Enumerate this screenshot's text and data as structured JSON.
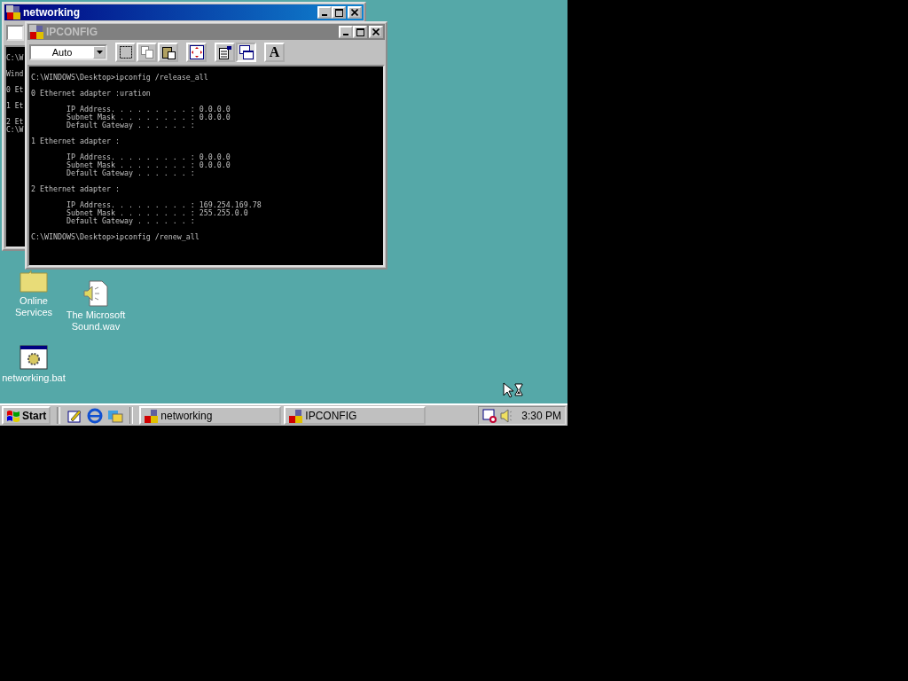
{
  "desktop_icons": [
    {
      "kind": "folder",
      "label": "Online Services"
    },
    {
      "kind": "sound",
      "label": "The Microsoft Sound.wav"
    },
    {
      "kind": "batch",
      "label": "networking.bat"
    }
  ],
  "windows": [
    {
      "title": "networking",
      "active": true,
      "console_blocks": [
        [
          "C:\\W"
        ],
        [
          "Wind"
        ],
        [
          "0 Et"
        ],
        [
          "1 Et"
        ],
        [
          "2 Et",
          "C:\\W"
        ]
      ]
    },
    {
      "title": "IPCONFIG",
      "active": false,
      "font_size": "Auto",
      "toolbar": [
        {
          "kind": "mark",
          "selected": false
        },
        {
          "kind": "copy",
          "selected": false
        },
        {
          "kind": "paste",
          "selected": false
        },
        {
          "kind": "fullscreen",
          "selected": false
        },
        {
          "kind": "properties",
          "selected": false
        },
        {
          "kind": "background",
          "selected": true
        },
        {
          "kind": "font",
          "label": "A",
          "selected": false
        }
      ],
      "console_blocks": [
        [
          "C:\\WINDOWS\\Desktop>ipconfig /release_all"
        ],
        [
          "0 Ethernet adapter :uration"
        ],
        [
          "        IP Address. . . . . . . . . : 0.0.0.0",
          "        Subnet Mask . . . . . . . . : 0.0.0.0",
          "        Default Gateway . . . . . . :"
        ],
        [
          "1 Ethernet adapter :"
        ],
        [
          "        IP Address. . . . . . . . . : 0.0.0.0",
          "        Subnet Mask . . . . . . . . : 0.0.0.0",
          "        Default Gateway . . . . . . :"
        ],
        [
          "2 Ethernet adapter :"
        ],
        [
          "        IP Address. . . . . . . . . : 169.254.169.78",
          "        Subnet Mask . . . . . . . . : 255.255.0.0",
          "        Default Gateway . . . . . . :"
        ],
        [
          "C:\\WINDOWS\\Desktop>ipconfig /renew_all"
        ]
      ]
    }
  ],
  "taskbar": {
    "start": "Start",
    "quick_launch": [
      {
        "kind": "desktop"
      },
      {
        "kind": "browser"
      },
      {
        "kind": "channels"
      }
    ],
    "tasks": [
      {
        "label": "networking",
        "selected": false
      },
      {
        "label": "IPCONFIG",
        "selected": false
      }
    ],
    "tray": [
      {
        "kind": "scheduler"
      },
      {
        "kind": "volume"
      }
    ],
    "clock": "3:30 PM"
  }
}
